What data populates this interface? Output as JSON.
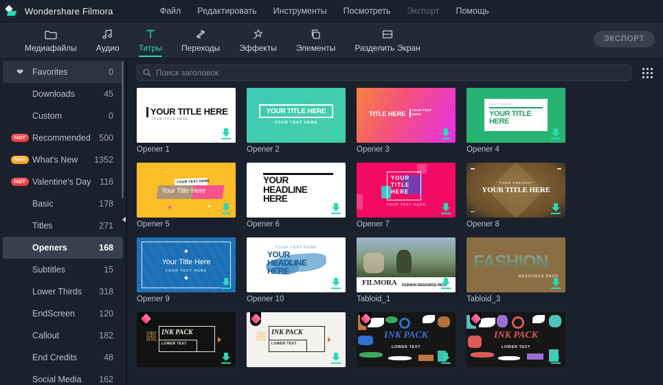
{
  "titlebar": {
    "app_name": "Wondershare Filmora",
    "logo_icon": "filmora-logo-icon",
    "menus": [
      {
        "label": "Файл",
        "disabled": false
      },
      {
        "label": "Редактировать",
        "disabled": false
      },
      {
        "label": "Инструменты",
        "disabled": false
      },
      {
        "label": "Посмотреть",
        "disabled": false
      },
      {
        "label": "Экспорт",
        "disabled": true
      },
      {
        "label": "Помощь",
        "disabled": false
      }
    ]
  },
  "toolbar": {
    "tabs": [
      {
        "id": "media",
        "label": "Медиафайлы",
        "icon": "folder-icon",
        "active": false
      },
      {
        "id": "audio",
        "label": "Аудио",
        "icon": "music-note-icon",
        "active": false
      },
      {
        "id": "titles",
        "label": "Титры",
        "icon": "text-t-icon",
        "active": true
      },
      {
        "id": "transitions",
        "label": "Переходы",
        "icon": "transition-icon",
        "active": false
      },
      {
        "id": "effects",
        "label": "Эффекты",
        "icon": "magic-wand-icon",
        "active": false
      },
      {
        "id": "elements",
        "label": "Элементы",
        "icon": "layers-icon",
        "active": false
      },
      {
        "id": "splitscreen",
        "label": "Разделить Экран",
        "icon": "split-screen-icon",
        "active": false
      }
    ],
    "export_label": "ЭКСПОРТ",
    "accent_color": "#2bd9b4"
  },
  "sidebar": {
    "collapse_icon": "collapse-left-arrow-icon",
    "items": [
      {
        "label": "Favorites",
        "count": "0",
        "badge": "",
        "icon": "heart-icon",
        "state": "favorite"
      },
      {
        "label": "Downloads",
        "count": "45",
        "badge": "",
        "icon": "",
        "state": ""
      },
      {
        "label": "Custom",
        "count": "0",
        "badge": "",
        "icon": "",
        "state": ""
      },
      {
        "label": "Recommended",
        "count": "500",
        "badge": "HOT",
        "icon": "",
        "state": ""
      },
      {
        "label": "What's New",
        "count": "1352",
        "badge": "New",
        "icon": "",
        "state": ""
      },
      {
        "label": "Valentine's Day",
        "count": "116",
        "badge": "HOT",
        "icon": "",
        "state": ""
      },
      {
        "label": "Basic",
        "count": "178",
        "badge": "",
        "icon": "",
        "state": ""
      },
      {
        "label": "Titles",
        "count": "271",
        "badge": "",
        "icon": "",
        "state": ""
      },
      {
        "label": "Openers",
        "count": "168",
        "badge": "",
        "icon": "",
        "state": "active"
      },
      {
        "label": "Subtitles",
        "count": "15",
        "badge": "",
        "icon": "",
        "state": ""
      },
      {
        "label": "Lower Thirds",
        "count": "318",
        "badge": "",
        "icon": "",
        "state": ""
      },
      {
        "label": "EndScreen",
        "count": "120",
        "badge": "",
        "icon": "",
        "state": ""
      },
      {
        "label": "Callout",
        "count": "182",
        "badge": "",
        "icon": "",
        "state": ""
      },
      {
        "label": "End Credits",
        "count": "48",
        "badge": "",
        "icon": "",
        "state": ""
      },
      {
        "label": "Social Media",
        "count": "162",
        "badge": "",
        "icon": "",
        "state": ""
      }
    ]
  },
  "search": {
    "placeholder": "Поиск заголовок",
    "value": "",
    "icon": "search-icon",
    "grid_toggle_icon": "grid-view-icon"
  },
  "grid": {
    "download_icon": "download-arrow-icon",
    "premium_icon": "premium-gem-icon",
    "items": [
      {
        "label": "Opener 1",
        "style": "op1",
        "title": "YOUR TITLE HERE",
        "sub": "YOUR TITLE HERE",
        "premium": false
      },
      {
        "label": "Opener 2",
        "style": "op2",
        "title": "YOUR TITLE HERE",
        "sub": "YOUR TEXT HERE",
        "premium": false
      },
      {
        "label": "Opener 3",
        "style": "op3",
        "title": "TITLE HERE",
        "sub": "YOUR TEXT HERE",
        "premium": false
      },
      {
        "label": "Opener 4",
        "style": "op4",
        "title": "YOUR TITLE HERE",
        "sub": "YOU PRESENT",
        "premium": false
      },
      {
        "label": "Opener 5",
        "style": "op5",
        "title": "Your Title Here",
        "sub": "YOUR TEXT HERE",
        "premium": false
      },
      {
        "label": "Opener 6",
        "style": "op6",
        "title": "YOUR HEADLINE HERE",
        "sub": "",
        "premium": false
      },
      {
        "label": "Opener 7",
        "style": "op7",
        "title": "YOUR TITLE HERE",
        "sub": "YOUR TEXT HERE",
        "premium": false
      },
      {
        "label": "Opener 8",
        "style": "op8",
        "title": "YOUR TITLE HERE",
        "sub": "YOUR PRESENT",
        "premium": false
      },
      {
        "label": "Opener 9",
        "style": "op9",
        "title": "Your Title Here",
        "sub": "YOUR TEXT HERE",
        "premium": false
      },
      {
        "label": "Opener 10",
        "style": "op10",
        "title": "YOUR HEADLINE HERE",
        "sub": "YOUR TEXT HERE",
        "premium": false
      },
      {
        "label": "Tabloid_1",
        "style": "tab1",
        "title": "FILMORA",
        "sub": "FASHION RESOURCE PACK",
        "premium": false
      },
      {
        "label": "Tabloid_3",
        "style": "tab3",
        "title": "FASHION",
        "sub": "RESOURCE PACK",
        "premium": false
      },
      {
        "label": "",
        "style": "ink1",
        "title": "INK PACK",
        "sub": "LOWER TEXT",
        "premium": true
      },
      {
        "label": "",
        "style": "ink2",
        "title": "INK PACK",
        "sub": "LOWER TEXT",
        "premium": true
      },
      {
        "label": "",
        "style": "ink3",
        "title": "INK PACK",
        "sub": "LOWER TEXT",
        "premium": true
      },
      {
        "label": "",
        "style": "ink4",
        "title": "INK PACK",
        "sub": "LOWER TEXT",
        "premium": true
      }
    ]
  }
}
